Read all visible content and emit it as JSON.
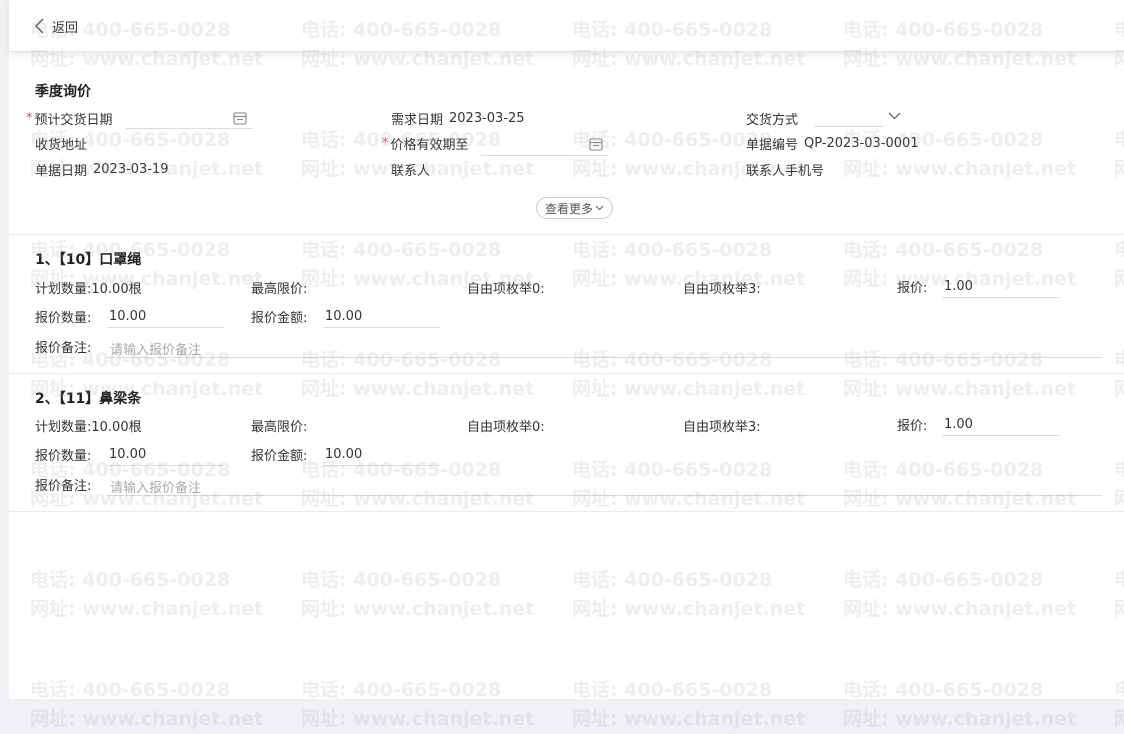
{
  "header": {
    "back_label": "返回"
  },
  "form": {
    "title": "季度询价",
    "expected_delivery_label": "预计交货日期",
    "demand_date_label": "需求日期",
    "demand_date_value": "2023-03-25",
    "delivery_method_label": "交货方式",
    "receive_address_label": "收货地址",
    "price_valid_until_label": "价格有效期至",
    "doc_no_label": "单据编号",
    "doc_no_value": "QP-2023-03-0001",
    "doc_date_label": "单据日期",
    "doc_date_value": "2023-03-19",
    "contact_label": "联系人",
    "contact_phone_label": "联系人手机号",
    "more_label": "查看更多"
  },
  "items": [
    {
      "title": "1、【10】口罩绳",
      "plan_qty": "计划数量:10.00根",
      "max_price_label": "最高限价:",
      "free_enum0_label": "自由项枚举0:",
      "free_enum3_label": "自由项枚举3:",
      "quote_price_label": "报价:",
      "quote_price_value": "1.00",
      "quote_qty_label": "报价数量:",
      "quote_qty_value": "10.00",
      "quote_amount_label": "报价金额:",
      "quote_amount_value": "10.00",
      "note_label": "报价备注:",
      "note_placeholder": "请输入报价备注"
    },
    {
      "title": "2、【11】鼻梁条",
      "plan_qty": "计划数量:10.00根",
      "max_price_label": "最高限价:",
      "free_enum0_label": "自由项枚举0:",
      "free_enum3_label": "自由项枚举3:",
      "quote_price_label": "报价:",
      "quote_price_value": "1.00",
      "quote_qty_label": "报价数量:",
      "quote_qty_value": "10.00",
      "quote_amount_label": "报价金额:",
      "quote_amount_value": "10.00",
      "note_label": "报价备注:",
      "note_placeholder": "请输入报价备注"
    }
  ],
  "watermark": {
    "phone": "电话: 400-665-0028",
    "site": "网址: www.chanjet.net"
  }
}
